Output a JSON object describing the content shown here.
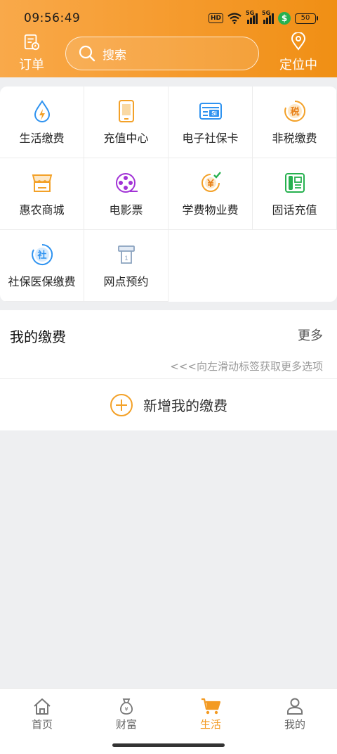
{
  "status_bar": {
    "time": "09:56:49",
    "hd": "HD",
    "signal_1": "5G",
    "signal_2": "5G",
    "battery": "50"
  },
  "header": {
    "order_label": "订单",
    "search_placeholder": "搜索",
    "location_label": "定位中",
    "colors": {
      "gradient_start": "#f9a94a",
      "gradient_end": "#f08f14"
    }
  },
  "services": [
    {
      "label": "生活缴费",
      "icon": "water-lightning-icon"
    },
    {
      "label": "充值中心",
      "icon": "phone-icon"
    },
    {
      "label": "电子社保卡",
      "icon": "si-card-icon"
    },
    {
      "label": "非税缴费",
      "icon": "tax-icon"
    },
    {
      "label": "惠农商城",
      "icon": "shop-icon"
    },
    {
      "label": "电影票",
      "icon": "film-reel-icon"
    },
    {
      "label": "学费物业费",
      "icon": "yuan-tuition-icon"
    },
    {
      "label": "固话充值",
      "icon": "landline-icon"
    },
    {
      "label": "社保医保缴费",
      "icon": "social-insurance-icon"
    },
    {
      "label": "网点预约",
      "icon": "queue-ticket-icon"
    }
  ],
  "my_payments": {
    "title": "我的缴费",
    "more": "更多",
    "hint": "<<<向左滑动标签获取更多选项",
    "add_label": "新增我的缴费"
  },
  "tabbar": {
    "tabs": [
      {
        "label": "首页",
        "icon": "home-icon",
        "active": false
      },
      {
        "label": "财富",
        "icon": "money-bag-icon",
        "active": false
      },
      {
        "label": "生活",
        "icon": "shopping-cart-icon",
        "active": true
      },
      {
        "label": "我的",
        "icon": "user-icon",
        "active": false
      }
    ],
    "active_color": "#f39a22"
  }
}
